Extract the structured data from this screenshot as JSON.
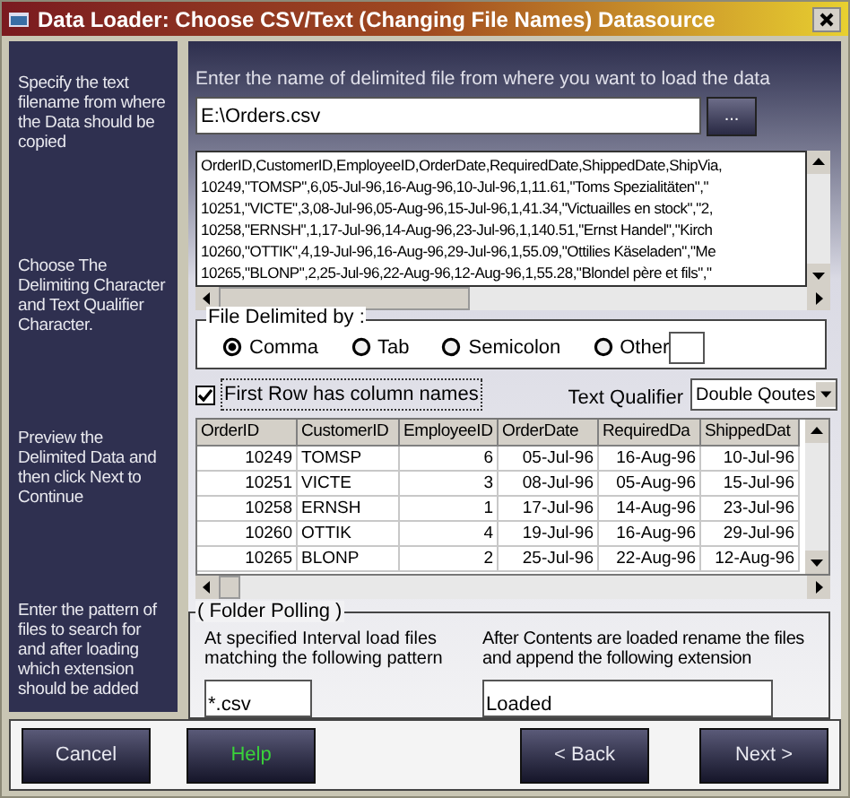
{
  "window": {
    "title": "Data Loader: Choose CSV/Text (Changing File Names) Datasource"
  },
  "steps": [
    {
      "text": "Specify the text filename from where the Data should be copied"
    },
    {
      "text": "Choose The Delimiting Character and Text Qualifier Character."
    },
    {
      "text": "Preview the Delimited Data and then click Next to Continue"
    },
    {
      "text": "Enter the pattern of files to search for and after loading which extension should be added"
    }
  ],
  "file": {
    "label": "Enter the name of delimited file from where you want to load the data",
    "value": "E:\\Orders.csv",
    "browse_button": "..."
  },
  "preview_lines": [
    "OrderID,CustomerID,EmployeeID,OrderDate,RequiredDate,ShippedDate,ShipVia,",
    "10249,\"TOMSP\",6,05-Jul-96,16-Aug-96,10-Jul-96,1,11.61,\"Toms Spezialitäten\",\"",
    "10251,\"VICTE\",3,08-Jul-96,05-Aug-96,15-Jul-96,1,41.34,\"Victuailles en stock\",\"2,",
    "10258,\"ERNSH\",1,17-Jul-96,14-Aug-96,23-Jul-96,1,140.51,\"Ernst Handel\",\"Kirch",
    "10260,\"OTTIK\",4,19-Jul-96,16-Aug-96,29-Jul-96,1,55.09,\"Ottilies Käseladen\",\"Me",
    "10265,\"BLONP\",2,25-Jul-96,22-Aug-96,12-Aug-96,1,55.28,\"Blondel père et fils\",\""
  ],
  "delimiter": {
    "legend": "File Delimited by :",
    "options": [
      {
        "label": "Comma",
        "selected": true
      },
      {
        "label": "Tab",
        "selected": false
      },
      {
        "label": "Semicolon",
        "selected": false
      },
      {
        "label": "Other",
        "selected": false
      }
    ]
  },
  "first_row_names": {
    "label": "First Row has column names",
    "checked": true
  },
  "text_qualifier": {
    "label": "Text Qualifier",
    "value": "Double Qoutes"
  },
  "grid": {
    "columns": [
      {
        "name": "OrderID",
        "kind": "number"
      },
      {
        "name": "CustomerID",
        "kind": "text"
      },
      {
        "name": "EmployeeID",
        "kind": "number"
      },
      {
        "name": "OrderDate",
        "kind": "date"
      },
      {
        "name": "RequiredDa",
        "kind": "date"
      },
      {
        "name": "ShippedDat",
        "kind": "date"
      }
    ],
    "rows": [
      [
        "10249",
        "TOMSP",
        "6",
        "05-Jul-96",
        "16-Aug-96",
        "10-Jul-96"
      ],
      [
        "10251",
        "VICTE",
        "3",
        "08-Jul-96",
        "05-Aug-96",
        "15-Jul-96"
      ],
      [
        "10258",
        "ERNSH",
        "1",
        "17-Jul-96",
        "14-Aug-96",
        "23-Jul-96"
      ],
      [
        "10260",
        "OTTIK",
        "4",
        "19-Jul-96",
        "16-Aug-96",
        "29-Jul-96"
      ],
      [
        "10265",
        "BLONP",
        "2",
        "25-Jul-96",
        "22-Aug-96",
        "12-Aug-96"
      ]
    ]
  },
  "folder_polling": {
    "legend": "( Folder Polling )",
    "pattern_label": "At specified Interval load files matching the following pattern",
    "pattern": "*.csv",
    "extension_label": "After Contents are loaded rename the files and append the following extension",
    "extension": "Loaded"
  },
  "buttons": [
    {
      "label": "Cancel",
      "kind": "normal"
    },
    {
      "label": "Help",
      "kind": "help"
    },
    {
      "label": "< Back",
      "kind": "normal"
    },
    {
      "label": "Next >",
      "kind": "normal"
    }
  ]
}
